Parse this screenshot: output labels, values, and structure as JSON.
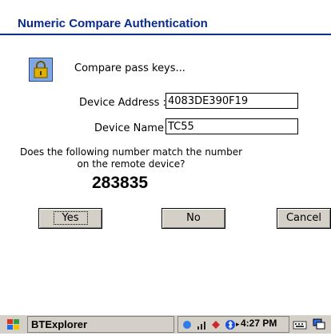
{
  "dialog": {
    "title": "Numeric Compare Authentication",
    "prompt": "Compare pass keys...",
    "device_address_label": "Device Address :",
    "device_address_value": "4083DE390F19",
    "device_name_label": "Device Name :",
    "device_name_value": "TC55",
    "question_line1": "Does the following number match the number",
    "question_line2": "on the remote device?",
    "passkey": "283835",
    "buttons": {
      "yes": "Yes",
      "no": "No",
      "cancel": "Cancel"
    }
  },
  "taskbar": {
    "app": "BTExplorer",
    "time": "4:27 PM"
  }
}
